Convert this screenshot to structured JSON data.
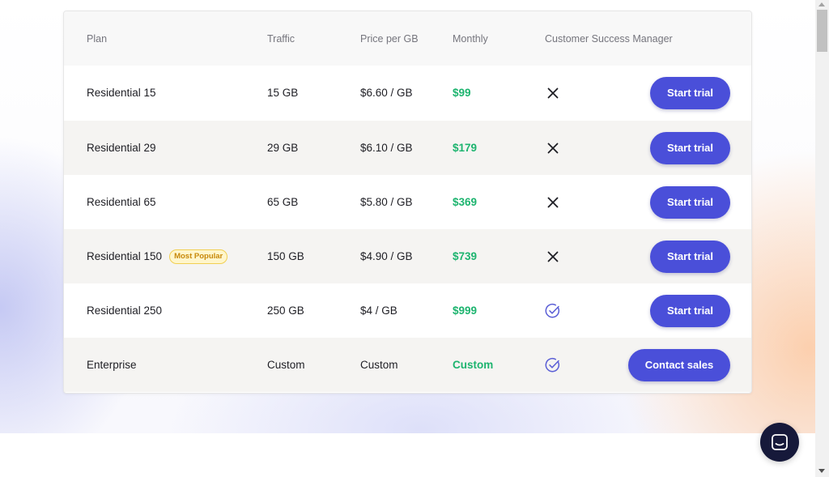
{
  "table": {
    "headers": {
      "plan": "Plan",
      "traffic": "Traffic",
      "price": "Price per GB",
      "monthly": "Monthly",
      "csm": "Customer Success Manager"
    },
    "rows": [
      {
        "plan": "Residential 15",
        "traffic": "15 GB",
        "price": "$6.60 / GB",
        "monthly": "$99",
        "csm": "x-icon",
        "action": "Start trial"
      },
      {
        "plan": "Residential 29",
        "traffic": "29 GB",
        "price": "$6.10 / GB",
        "monthly": "$179",
        "csm": "x-icon",
        "action": "Start trial"
      },
      {
        "plan": "Residential 65",
        "traffic": "65 GB",
        "price": "$5.80 / GB",
        "monthly": "$369",
        "csm": "x-icon",
        "action": "Start trial"
      },
      {
        "plan": "Residential 150",
        "badge": "Most Popular",
        "traffic": "150 GB",
        "price": "$4.90 / GB",
        "monthly": "$739",
        "csm": "x-icon",
        "action": "Start trial"
      },
      {
        "plan": "Residential 250",
        "traffic": "250 GB",
        "price": "$4 / GB",
        "monthly": "$999",
        "csm": "check-circle-icon",
        "action": "Start trial"
      },
      {
        "plan": "Enterprise",
        "traffic": "Custom",
        "price": "Custom",
        "monthly": "Custom",
        "csm": "check-circle-icon",
        "action": "Contact sales"
      }
    ]
  },
  "colors": {
    "accent": "#4a4fd9",
    "monthly_text": "#1db46f",
    "check_icon": "#5b5fd6",
    "chat_button": "#16193a",
    "badge_bg": "#fff6cc",
    "badge_text": "#c7890a"
  },
  "chat": {
    "icon": "chat-bubble-icon"
  }
}
